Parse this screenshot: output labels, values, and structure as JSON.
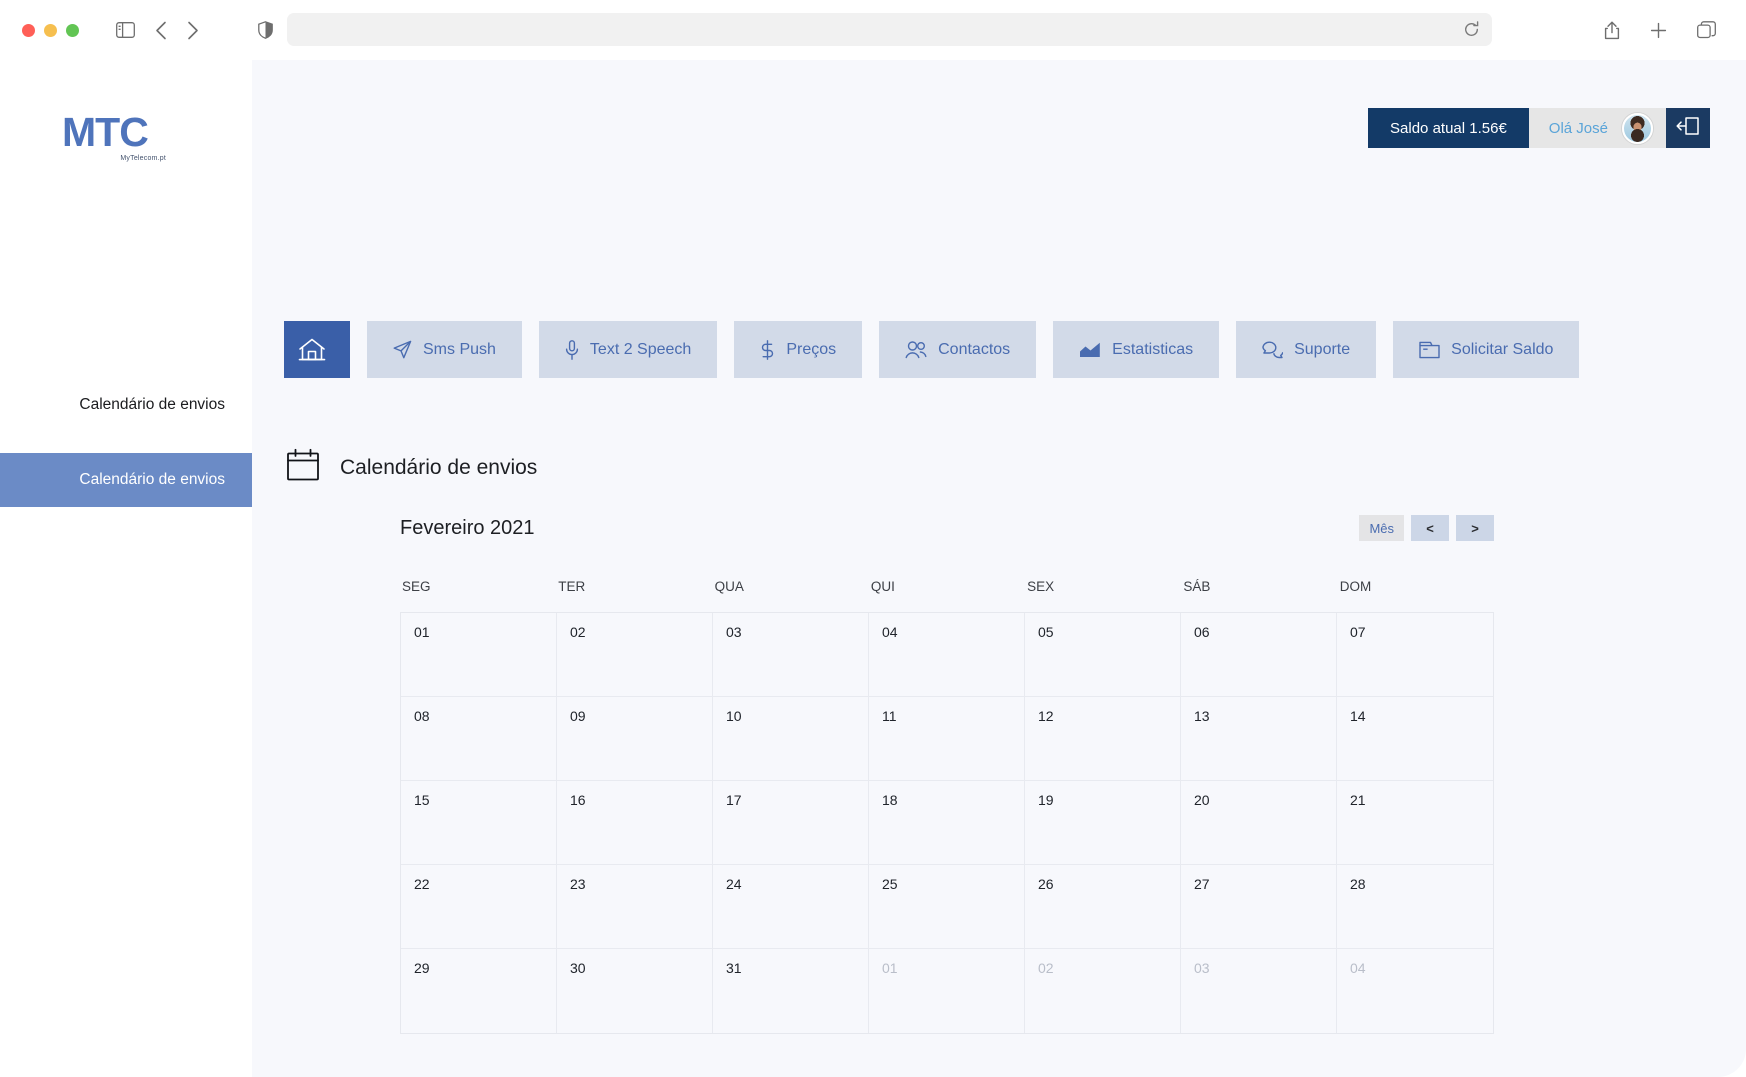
{
  "browser": {
    "icons": {
      "sidebar_toggle": "sidebar-toggle-icon",
      "back": "back-arrow-icon",
      "forward": "forward-arrow-icon",
      "shield": "privacy-shield-icon",
      "reload": "reload-icon",
      "share": "share-icon",
      "new_tab": "plus-icon",
      "tab_overview": "tab-overview-icon"
    },
    "address_value": "",
    "address_placeholder": ""
  },
  "sidebar": {
    "logo": {
      "mark": "MTC",
      "sub": "MyTelecom.pt"
    },
    "items": [
      {
        "label": "Calendário de envios",
        "active": false
      },
      {
        "label": "Calendário de envios",
        "active": true
      }
    ]
  },
  "userbar": {
    "balance_label": "Saldo atual 1.56€",
    "greeting": "Olá José",
    "avatar_name": "avatar",
    "logout_icon": "logout-icon"
  },
  "nav": {
    "tabs": [
      {
        "label": "",
        "icon": "home-icon",
        "active": true
      },
      {
        "label": "Sms Push",
        "icon": "send-icon",
        "active": false
      },
      {
        "label": "Text 2 Speech",
        "icon": "microphone-icon",
        "active": false
      },
      {
        "label": "Preços",
        "icon": "dollar-icon",
        "active": false
      },
      {
        "label": "Contactos",
        "icon": "users-icon",
        "active": false
      },
      {
        "label": "Estatisticas",
        "icon": "chart-icon",
        "active": false
      },
      {
        "label": "Suporte",
        "icon": "chat-icon",
        "active": false
      },
      {
        "label": "Solicitar Saldo",
        "icon": "wallet-icon",
        "active": false
      }
    ]
  },
  "page": {
    "title": "Calendário de envios",
    "title_icon": "calendar-icon"
  },
  "calendar": {
    "month_label": "Fevereiro 2021",
    "view_button": "Mês",
    "prev_button": "<",
    "next_button": ">",
    "weekdays": [
      "SEG",
      "TER",
      "QUA",
      "QUI",
      "SEX",
      "SÁB",
      "DOM"
    ],
    "days": [
      {
        "n": "01",
        "muted": false
      },
      {
        "n": "02",
        "muted": false
      },
      {
        "n": "03",
        "muted": false
      },
      {
        "n": "04",
        "muted": false
      },
      {
        "n": "05",
        "muted": false
      },
      {
        "n": "06",
        "muted": false
      },
      {
        "n": "07",
        "muted": false
      },
      {
        "n": "08",
        "muted": false
      },
      {
        "n": "09",
        "muted": false
      },
      {
        "n": "10",
        "muted": false
      },
      {
        "n": "11",
        "muted": false
      },
      {
        "n": "12",
        "muted": false
      },
      {
        "n": "13",
        "muted": false
      },
      {
        "n": "14",
        "muted": false
      },
      {
        "n": "15",
        "muted": false
      },
      {
        "n": "16",
        "muted": false
      },
      {
        "n": "17",
        "muted": false
      },
      {
        "n": "18",
        "muted": false
      },
      {
        "n": "19",
        "muted": false
      },
      {
        "n": "20",
        "muted": false
      },
      {
        "n": "21",
        "muted": false
      },
      {
        "n": "22",
        "muted": false
      },
      {
        "n": "23",
        "muted": false
      },
      {
        "n": "24",
        "muted": false
      },
      {
        "n": "25",
        "muted": false
      },
      {
        "n": "26",
        "muted": false
      },
      {
        "n": "27",
        "muted": false
      },
      {
        "n": "28",
        "muted": false
      },
      {
        "n": "29",
        "muted": false
      },
      {
        "n": "30",
        "muted": false
      },
      {
        "n": "31",
        "muted": false
      },
      {
        "n": "01",
        "muted": true
      },
      {
        "n": "02",
        "muted": true
      },
      {
        "n": "03",
        "muted": true
      },
      {
        "n": "04",
        "muted": true
      }
    ]
  },
  "colors": {
    "brand_blue": "#4f74bb",
    "nav_active": "#3a5fa8",
    "nav_tab_bg": "#d2dae8",
    "sidebar_active": "#6b8bc6",
    "navy": "#133a67",
    "greet_blue": "#5aa4d8",
    "content_bg": "#f7f8fc"
  }
}
